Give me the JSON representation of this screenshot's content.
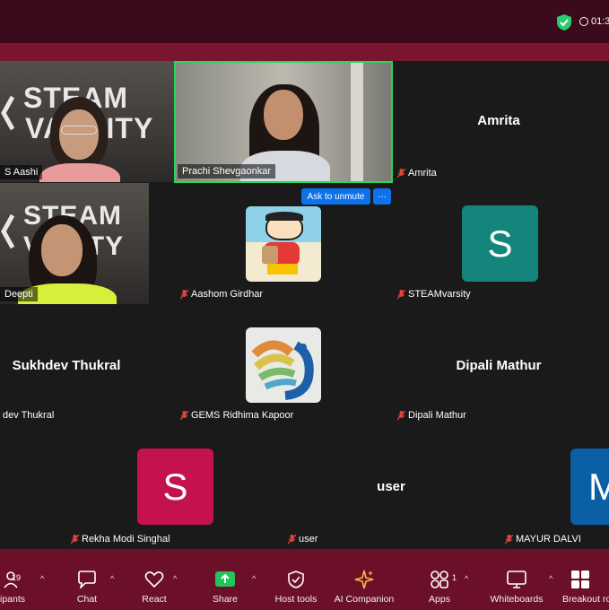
{
  "header": {
    "timer": "01:3",
    "shield_color": "#2ecc71",
    "shield_icon": "shield-check-icon"
  },
  "unmute_prompt": {
    "label": "Ask to unmute",
    "more_label": "···"
  },
  "tiles": {
    "aashi": {
      "label": "S Aashi"
    },
    "prachi": {
      "label": "Prachi Shevgaonkar",
      "active_speaker_color": "#23d959"
    },
    "amrita": {
      "display": "Amrita",
      "label": "Amrita"
    },
    "deepti": {
      "label": "Deepti"
    },
    "aashom": {
      "label": "Aashom Girdhar"
    },
    "steamvarsity": {
      "letter": "S",
      "label": "STEAMvarsity",
      "color": "#14857a"
    },
    "sukhdev": {
      "display": "Sukhdev Thukral",
      "label": "dev Thukral"
    },
    "ridhima": {
      "label": "GEMS Ridhima Kapoor"
    },
    "dipali": {
      "display": "Dipali Mathur",
      "label": "Dipali Mathur"
    },
    "rekha": {
      "letter": "S",
      "label": "Rekha Modi Singhal",
      "color": "#c4124f"
    },
    "user": {
      "display": "user",
      "label": "user"
    },
    "mayur": {
      "letter": "M",
      "label": "MAYUR DALVI",
      "color": "#0b5fa5"
    }
  },
  "steam_logo": {
    "line1": "STEAM",
    "line2": "VARSITY",
    "line2_partial": "VASITY"
  },
  "toolbar": {
    "participants": {
      "label": "ipants",
      "count": "19",
      "icon": "participants-icon"
    },
    "chat": {
      "label": "Chat",
      "icon": "chat-icon"
    },
    "react": {
      "label": "React",
      "icon": "heart-icon"
    },
    "share": {
      "label": "Share",
      "icon": "share-icon",
      "color": "#23c45e"
    },
    "host_tools": {
      "label": "Host tools",
      "icon": "shield-icon"
    },
    "ai_companion": {
      "label": "AI Companion",
      "icon": "sparkle-icon",
      "color": "#f2b84b"
    },
    "apps": {
      "label": "Apps",
      "count": "1",
      "icon": "apps-icon"
    },
    "whiteboards": {
      "label": "Whiteboards",
      "icon": "whiteboard-icon"
    },
    "breakout": {
      "label": "Breakout ro",
      "icon": "breakout-rooms-icon"
    }
  }
}
